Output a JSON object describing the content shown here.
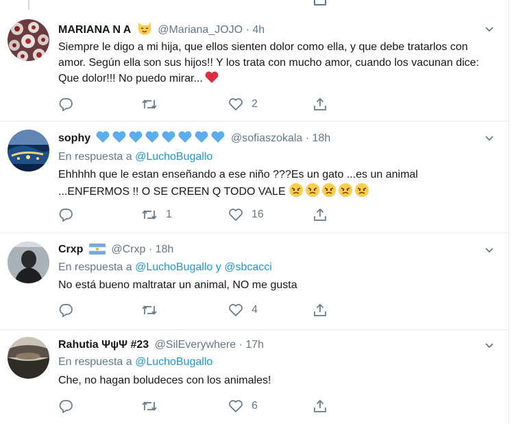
{
  "tweets": [
    {
      "name": "MARIANA N A",
      "handle": "@Mariana_JOJO",
      "time": "· 4h",
      "badge_icon": "cat-face-emoji",
      "reply_prefix": "",
      "reply_users": [],
      "text": "Siempre le digo a mi hija, que ellos sienten dolor como ella, y que debe tratarlos con amor. Según ella son sus hijos!! Y los trata con mucho amor, cuando los vacunan dice: Que dolor!!! No puedo mirar...",
      "text_emoji": "red-heart-emoji",
      "retweets": "",
      "likes": "2"
    },
    {
      "name": "sophy",
      "handle": "@sofiaszokala",
      "time": "· 18h",
      "badge_icon": "blue-heart-emoji x8",
      "reply_prefix": "En respuesta a",
      "reply_users": [
        "@LuchoBugallo"
      ],
      "text": "Ehhhhh  que le estan enseñando a ese niño ???Es un gato ...es un animal ...ENFERMOS !! O SE CREEN Q TODO VALE",
      "text_emoji": "angry-face-emoji x5",
      "retweets": "1",
      "likes": "16"
    },
    {
      "name": "Crxp",
      "handle": "@Crxp",
      "time": "· 18h",
      "badge_icon": "argentina-flag-emoji",
      "reply_prefix": "En respuesta a",
      "reply_users": [
        "@LuchoBugallo",
        "@sbcacci"
      ],
      "reply_joiner": "y",
      "text": "No está bueno maltratar un animal, NO me gusta",
      "retweets": "",
      "likes": "4"
    },
    {
      "name": "Rahutia ΨψΨ #23",
      "handle": "@SilEverywhere",
      "time": "· 17h",
      "reply_prefix": "En respuesta a",
      "reply_users": [
        "@LuchoBugallo"
      ],
      "text": "Che, no hagan boludeces con los animales!",
      "retweets": "",
      "likes": "6"
    }
  ],
  "colors": {
    "text": "#14171a",
    "muted": "#657786",
    "link": "#1b95e0",
    "divider": "#e6ecf0",
    "heart_blue": "#5dadec",
    "heart_red": "#dd2e44",
    "angry_yellow": "#ffcc4d"
  }
}
